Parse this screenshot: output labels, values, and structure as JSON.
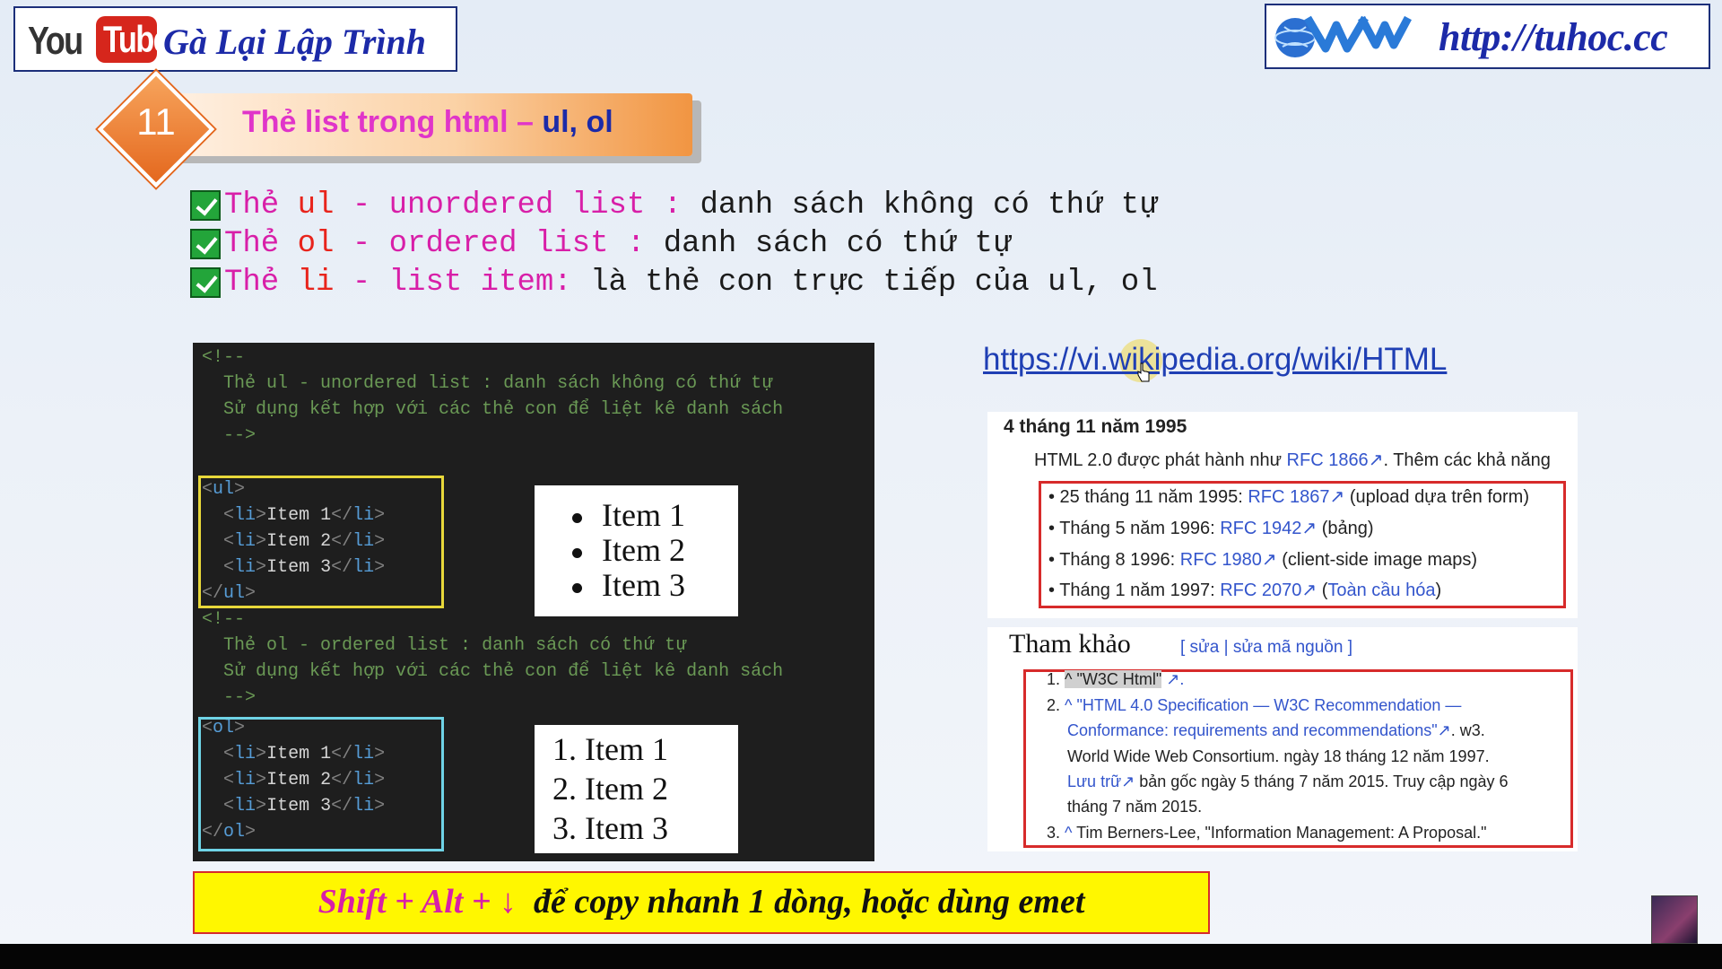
{
  "youtube": {
    "you": "You",
    "tube": "Tube",
    "channel": "Gà Lại Lập Trình"
  },
  "website": {
    "url": "http://tuhoc.cc"
  },
  "lesson": {
    "number": "11",
    "title_prefix": "Thẻ list trong html – ",
    "title_highlight": "ul, ol"
  },
  "bullets": [
    {
      "pink1": "Thẻ ",
      "red": "ul",
      "pink2": " - unordered list : ",
      "black": "danh sách không có thứ tự"
    },
    {
      "pink1": "Thẻ ",
      "red": "ol",
      "pink2": " - ordered list : ",
      "black": "danh sách có thứ tự"
    },
    {
      "pink1": "Thẻ ",
      "red": "li",
      "pink2": " - list item: ",
      "black": "là thẻ con trực tiếp của ul, ol"
    }
  ],
  "code": {
    "comment_open": "<!--",
    "comment_close": "-->",
    "ul_comment_1": "Thẻ ul - unordered list : danh sách không có thứ tự",
    "ol_comment_1": "Thẻ ol - ordered list : danh sách có thứ tự",
    "comment_2": "Sử dụng kết hợp với các thẻ con để liệt kê danh sách",
    "ul_tag": "ul",
    "ol_tag": "ol",
    "li_tag": "li",
    "items": [
      "Item 1",
      "Item 2",
      "Item 3"
    ]
  },
  "preview": {
    "ul_items": [
      "Item 1",
      "Item 2",
      "Item 3"
    ],
    "ol_items": [
      "1. Item 1",
      "2. Item 2",
      "3. Item 3"
    ]
  },
  "wiki_link": "https://vi.wikipedia.org/wiki/HTML",
  "wiki_history": {
    "date": "4 tháng 11 năm 1995",
    "intro_text": "HTML 2.0 được phát hành như ",
    "intro_link": "RFC 1866",
    "intro_tail": ". Thêm các khả năng",
    "items": [
      {
        "prefix": "• 25 tháng 11 năm 1995: ",
        "link": "RFC 1867",
        "tail": " (upload dựa trên form)"
      },
      {
        "prefix": "• Tháng 5 năm 1996: ",
        "link": "RFC 1942",
        "tail": " (bảng)"
      },
      {
        "prefix": "• Tháng 8 1996: ",
        "link": "RFC 1980",
        "tail": " (client-side image maps)"
      },
      {
        "prefix": "• Tháng 1 năm 1997: ",
        "link": "RFC 2070",
        "tail_open": " (",
        "tail_link": "Toàn cầu hóa",
        "tail_close": ")"
      }
    ]
  },
  "wiki_refs": {
    "title": "Tham khảo",
    "edit": "[ sửa | sửa mã nguồn ]",
    "ref1_num": "1.",
    "ref1": "^ \"W3C Html\"",
    "ref2_num": "2.",
    "ref2_line1": "^ \"HTML 4.0 Specification — W3C Recommendation —",
    "ref2_line2_link": "Conformance: requirements and recommendations\"",
    "ref2_line2_tail": ". w3.",
    "ref2_line3": "World Wide Web Consortium. ngày 18 tháng 12 năm 1997.",
    "ref2_line4_link": "Lưu trữ",
    "ref2_line4_tail": " bản gốc ngày 5 tháng 7 năm 2015. Truy cập ngày 6",
    "ref2_line5": "tháng 7 năm 2015.",
    "ref3_num": "3.",
    "ref3_caret": "^",
    "ref3": " Tim Berners-Lee, \"Information Management: A Proposal.\""
  },
  "tip": {
    "keys": "Shift + Alt + ↓",
    "text": "  để copy nhanh 1 dòng, hoặc dùng emet"
  }
}
